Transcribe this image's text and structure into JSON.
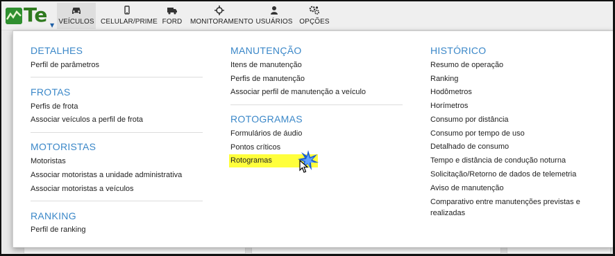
{
  "app": {
    "logo_text": "Te"
  },
  "nav": {
    "items": [
      {
        "label": "VEÍCULOS",
        "icon": "car-icon",
        "active": true
      },
      {
        "label": "CELULAR/PRIME",
        "icon": "mobile-icon",
        "active": false
      },
      {
        "label": "FORD",
        "icon": "truck-icon",
        "active": false
      },
      {
        "label": "MONITORAMENTO",
        "icon": "crosshair-icon",
        "active": false
      },
      {
        "label": "USUÁRIOS",
        "icon": "user-icon",
        "active": false
      },
      {
        "label": "OPÇÕES",
        "icon": "gears-icon",
        "active": false
      }
    ]
  },
  "menu": {
    "col1": {
      "detalhes": {
        "title": "DETALHES",
        "links": [
          "Perfil de parâmetros"
        ]
      },
      "frotas": {
        "title": "FROTAS",
        "links": [
          "Perfis de frota",
          "Associar veículos a perfil de frota"
        ]
      },
      "motoristas": {
        "title": "MOTORISTAS",
        "links": [
          "Motoristas",
          "Associar motoristas a unidade administrativa",
          "Associar motoristas a veículos"
        ]
      },
      "ranking": {
        "title": "RANKING",
        "links": [
          "Perfil de ranking"
        ]
      }
    },
    "col2": {
      "manutencao": {
        "title": "MANUTENÇÃO",
        "links": [
          "Itens de manutenção",
          "Perfis de manutenção",
          "Associar perfil de manutenção a veículo"
        ]
      },
      "rotogramas": {
        "title": "ROTOGRAMAS",
        "links": [
          "Formulários de áudio",
          "Pontos críticos",
          "Rotogramas"
        ]
      }
    },
    "col3": {
      "historico": {
        "title": "HISTÓRICO",
        "links": [
          "Resumo de operação",
          "Ranking",
          "Hodômetros",
          "Horímetros",
          "Consumo por distância",
          "Consumo por tempo de uso",
          "Detalhado de consumo",
          "Tempo e distância de condução noturna",
          "Solicitação/Retorno de dados de telemetria",
          "Aviso de manutenção",
          "Comparativo entre manutenções previstas e",
          "realizadas"
        ]
      }
    },
    "highlight_color": "#ffff3c",
    "accent_color": "#3a87c8"
  }
}
